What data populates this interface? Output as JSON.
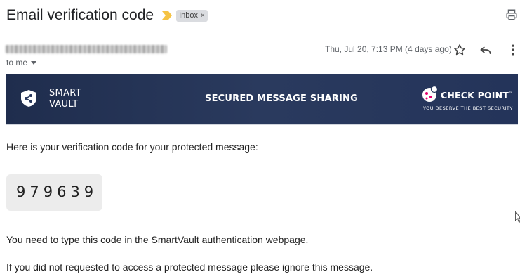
{
  "email": {
    "subject": "Email verification code",
    "label": "Inbox",
    "label_remove": "×",
    "recipient": "to me",
    "date": "Thu, Jul 20, 7:13 PM (4 days ago)"
  },
  "banner": {
    "brand_line1": "SMART",
    "brand_line2": "VAULT",
    "title": "SECURED MESSAGE SHARING",
    "partner_name": "CHECK POINT",
    "partner_tm": "™",
    "partner_tagline": "YOU DESERVE THE BEST SECURITY"
  },
  "message": {
    "intro": "Here is your verification code for your protected message:",
    "code": "979639",
    "instruction": "You need to type this code in the SmartVault authentication webpage.",
    "disclaimer": "If you did not requested to access a protected message please ignore this message."
  },
  "icons": {
    "important": "important-marker-icon",
    "print": "print-icon",
    "star": "star-icon",
    "reply": "reply-icon",
    "more": "more-vert-icon"
  },
  "colors": {
    "banner_bg": "#24345a",
    "important_marker": "#f5c344",
    "chip_bg": "#dadce0",
    "code_bg": "#ececec",
    "check_point_accent": "#e5006e"
  }
}
